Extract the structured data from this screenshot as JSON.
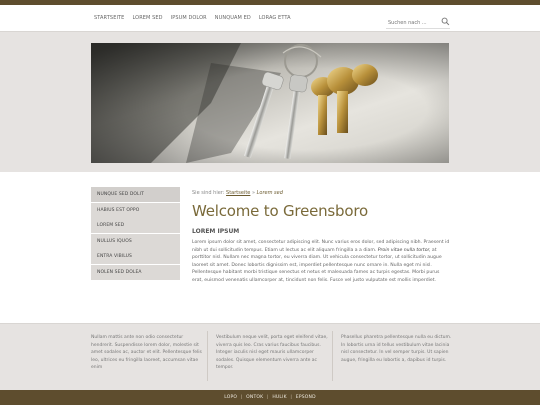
{
  "nav": {
    "items": [
      "STARTSEITE",
      "LOREM SED",
      "IPSUM DOLOR",
      "NUNQUAM ED",
      "LORAG ETTA"
    ]
  },
  "search": {
    "placeholder": "Suchen nach ...",
    "icon": "search-icon"
  },
  "hero": {
    "image": "keys-photo"
  },
  "sidebar": {
    "items": [
      "NUNQUE SED DOLIT",
      "HABIUS EST OPPO",
      "LOREM SED",
      "NULLUS IQUOS",
      "ENTRA VIBILUS",
      "NOLEN SED DOLEA"
    ]
  },
  "breadcrumb": {
    "prefix": "Sie sind hier:",
    "home": "Startseite",
    "sep": "»",
    "current": "Lorem sed"
  },
  "main": {
    "title": "Welcome to Greensboro",
    "subhead": "LOREM IPSUM",
    "para_a": "Lorem ipsum dolor sit amet, consectetur adipiscing elit. Nunc varius eros dolor, sed adipiscing nibh. Praesent id nibh ut dui sollicitudin tempus. Etiam ut lectus ac elit aliquam fringilla a a diam.",
    "para_em": "Proin vitae nulla tortor,",
    "para_b": "at porttitor nisl. Nullam nec magna tortor, eu viverra diam. Ut vehicula consectetur tortor, ut sollicitudin augue laoreet sit amet. Donec lobortis dignissim est, imperdiet pellentesque nunc ornare in. Nulla eget mi nisl. Pellentesque habitant morbi tristique senectus et netus et malesuada fames ac turpis egestas. Morbi purus erat, euismod venenatis ullamcorper at, tincidunt non felis. Fusce vel justo vulputate est mollis imperdiet."
  },
  "footer": {
    "col1": "Nullam mattis ante non odio consectetur hendrerit. Suspendisse lorem dolor, molestie sit amet sodales ac, auctor et elit. Pellentesque felis leo, ultrices eu fringilla laoreet, accumsan vitae enim",
    "col2": "Vestibulum neque velit, porta eget eleifend vitae, viverra quis leo. Cras varius faucibus faucibus. Integer iaculis nisl eget mauris ullamcorper sodales. Quisque elementum viverra ante ac tempor.",
    "col3": "Phasellus pharetra pellentesque nulla eu dictum. In lobortis urna id tellus vestibulum vitae lacinia nisl consectetur. In vel semper turpis. Ut sapien augue, fringilla eu lobortis a, dapibus id turpis."
  },
  "bottom": {
    "links": [
      "LOPO",
      "ONTOK",
      "HULIK",
      "EPSOND"
    ],
    "sep": "|"
  },
  "colors": {
    "brand": "#5e4d2e",
    "title": "#7a6a3a",
    "band": "#e6e3e1"
  }
}
